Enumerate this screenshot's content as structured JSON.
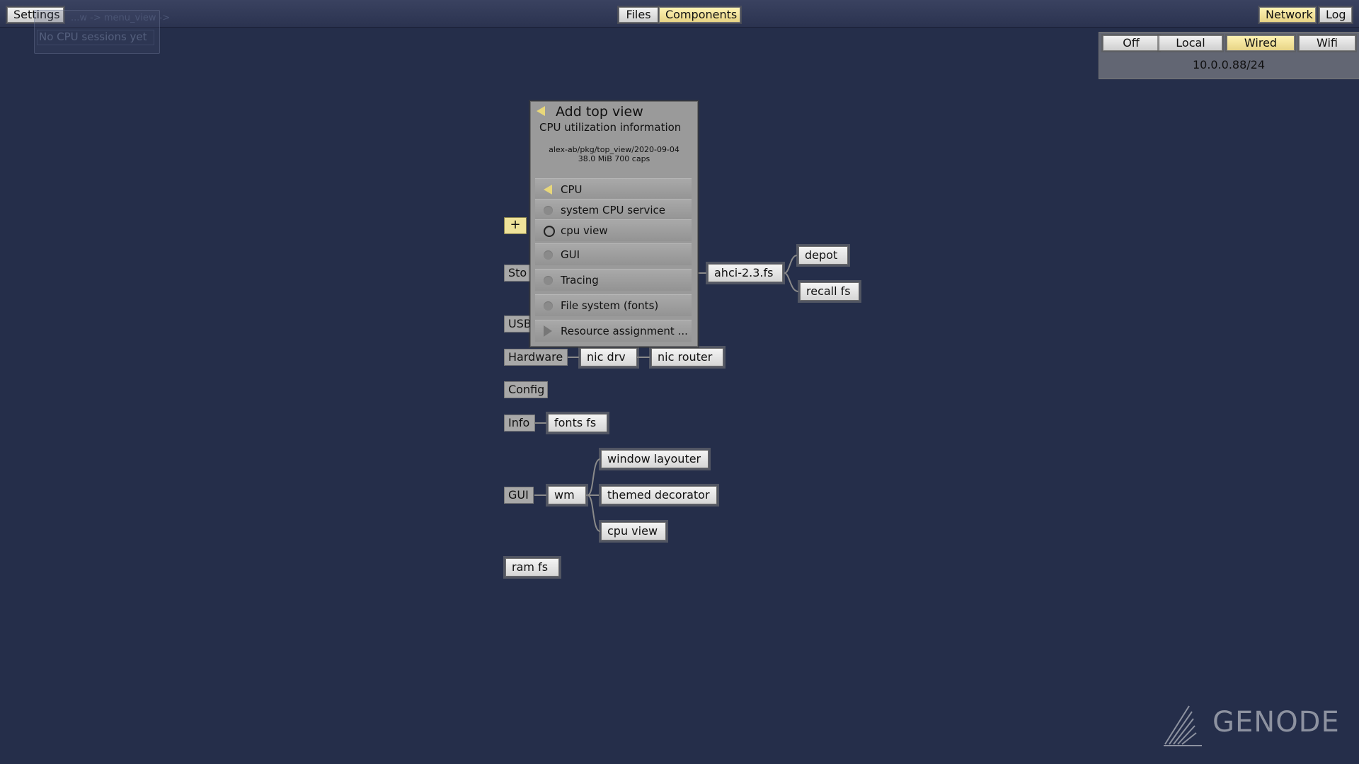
{
  "topbar": {
    "settings_label": "Settings",
    "files_label": "Files",
    "components_label": "Components",
    "network_label": "Network",
    "log_label": "Log"
  },
  "cpu_card": {
    "title": "...w -> menu_view ->",
    "text": "No CPU sessions yet"
  },
  "network_panel": {
    "modes": [
      "Off",
      "Local",
      "Wired",
      "Wifi"
    ],
    "selected": "Wired",
    "address": "10.0.0.88/24"
  },
  "menu": {
    "title": "Add top view",
    "description": "CPU utilization information",
    "path": "alex-ab/pkg/top_view/2020-09-04",
    "size_caps": "38.0 MiB 700 caps",
    "section": "CPU",
    "options": [
      "system CPU service",
      "cpu view",
      "GUI",
      "Tracing",
      "File system (fonts)"
    ],
    "resource": "Resource assignment ..."
  },
  "graph": {
    "plus_label": "+",
    "categories": [
      "Sto",
      "USB",
      "Hardware",
      "Config",
      "Info",
      "GUI"
    ],
    "nodes": {
      "ahci": "ahci-2.3.fs",
      "depot": "depot",
      "recall": "recall fs",
      "nic_drv": "nic drv",
      "nic_router": "nic router",
      "fonts_fs": "fonts fs",
      "wm": "wm",
      "window_layouter": "window layouter",
      "themed_decorator": "themed decorator",
      "cpu_view": "cpu view",
      "ram_fs": "ram fs"
    }
  },
  "logo": {
    "text": "GENODE",
    "icon": "genode-logo-icon"
  },
  "colors": {
    "background": "#252e4a",
    "selected": "#e7d486",
    "panel": "#9a9a9a"
  }
}
